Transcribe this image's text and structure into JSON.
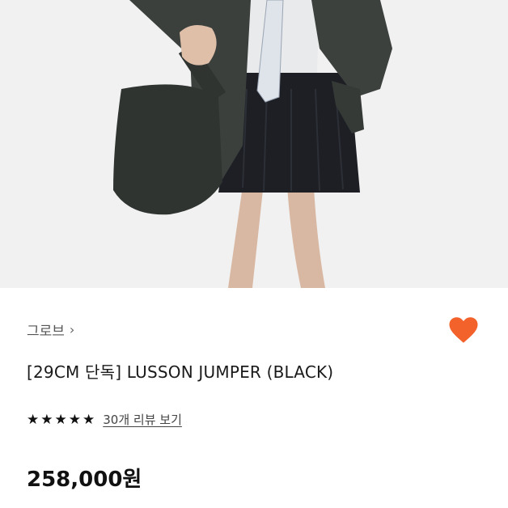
{
  "product": {
    "brand": "그로브",
    "title": "[29CM 단독] LUSSON JUMPER (BLACK)",
    "review_link": "30개 리뷰 보기",
    "price": "258,000원",
    "rating_stars": 5
  },
  "icons": {
    "brand_chevron": "chevron-right-icon",
    "wishlist": "heart-icon",
    "star": "star-icon"
  },
  "colors": {
    "heart": "#F4622B",
    "text": "#1a1a1a",
    "photo_bg": "#f2f2f2"
  }
}
